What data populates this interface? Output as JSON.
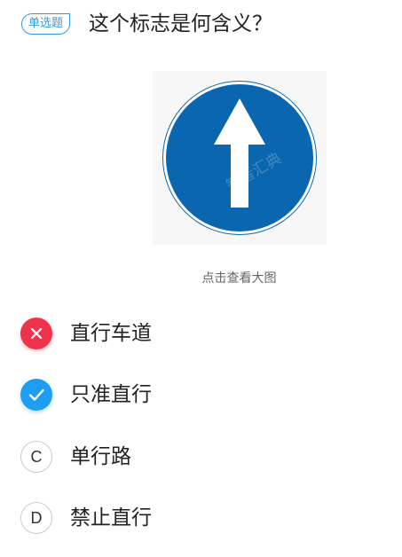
{
  "question": {
    "type_badge": "单选题",
    "text": "这个标志是何含义？"
  },
  "image": {
    "view_large_label": "点击查看大图",
    "watermark": "智者汇典",
    "sign_colors": {
      "background": "#0b66b0",
      "ring": "#ffffff",
      "arrow": "#ffffff"
    }
  },
  "options": [
    {
      "marker": "✕",
      "label": "直行车道",
      "state": "wrong",
      "icon": "close-icon"
    },
    {
      "marker": "✓",
      "label": "只准直行",
      "state": "correct",
      "icon": "check-icon"
    },
    {
      "marker": "C",
      "label": "单行路",
      "state": "unselected"
    },
    {
      "marker": "D",
      "label": "禁止直行",
      "state": "unselected"
    }
  ],
  "colors": {
    "accent": "#2f9be8",
    "wrong": "#f0334c",
    "correct": "#1e9ef0"
  }
}
